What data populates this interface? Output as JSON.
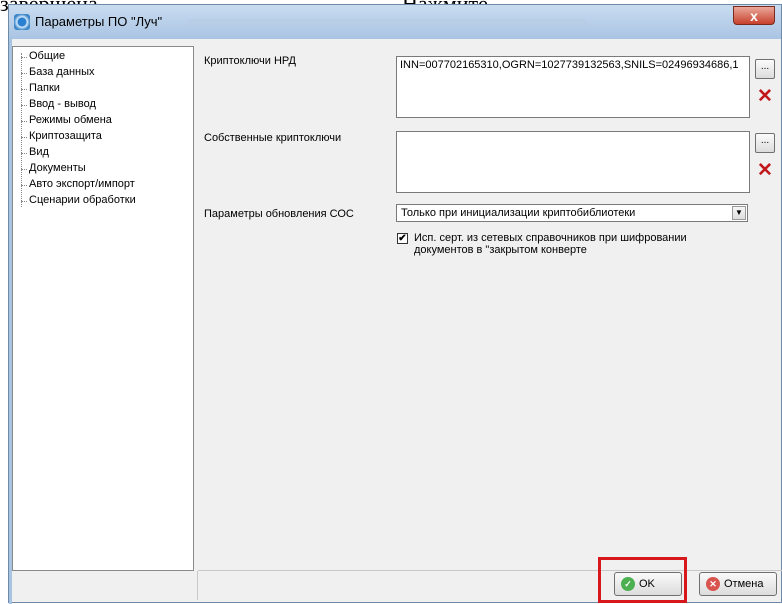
{
  "background_text": {
    "left": "завершена.",
    "right": "Нажмите"
  },
  "window": {
    "title": "Параметры ПО \"Луч\"",
    "close_glyph": "x"
  },
  "tree": {
    "items": [
      "Общие",
      "База данных",
      "Папки",
      "Ввод - вывод",
      "Режимы обмена",
      "Криптозащита",
      "Вид",
      "Документы",
      "Авто экспорт/импорт",
      "Сценарии обработки"
    ]
  },
  "form": {
    "nrd_keys_label": "Криптоключи НРД",
    "nrd_keys_value": "INN=007702165310,OGRN=1027739132563,SNILS=02496934686,1",
    "own_keys_label": "Собственные криптоключи",
    "own_keys_value": "",
    "browse_label": "...",
    "delete_glyph": "✕",
    "update_params_label": "Параметры обновления СОС",
    "update_params_value": "Только при инициализации криптобиблиотеки",
    "checkbox_checked": true,
    "checkbox_label_line1": "Исп. серт. из сетевых справочников при шифровании",
    "checkbox_label_line2": "документов в \"закрытом конверте"
  },
  "buttons": {
    "ok_label": "OK",
    "cancel_label": "Отмена"
  },
  "colors": {
    "highlight": "#d6171c",
    "ok_icon": "#4caf50",
    "cancel_icon": "#d9534f"
  }
}
